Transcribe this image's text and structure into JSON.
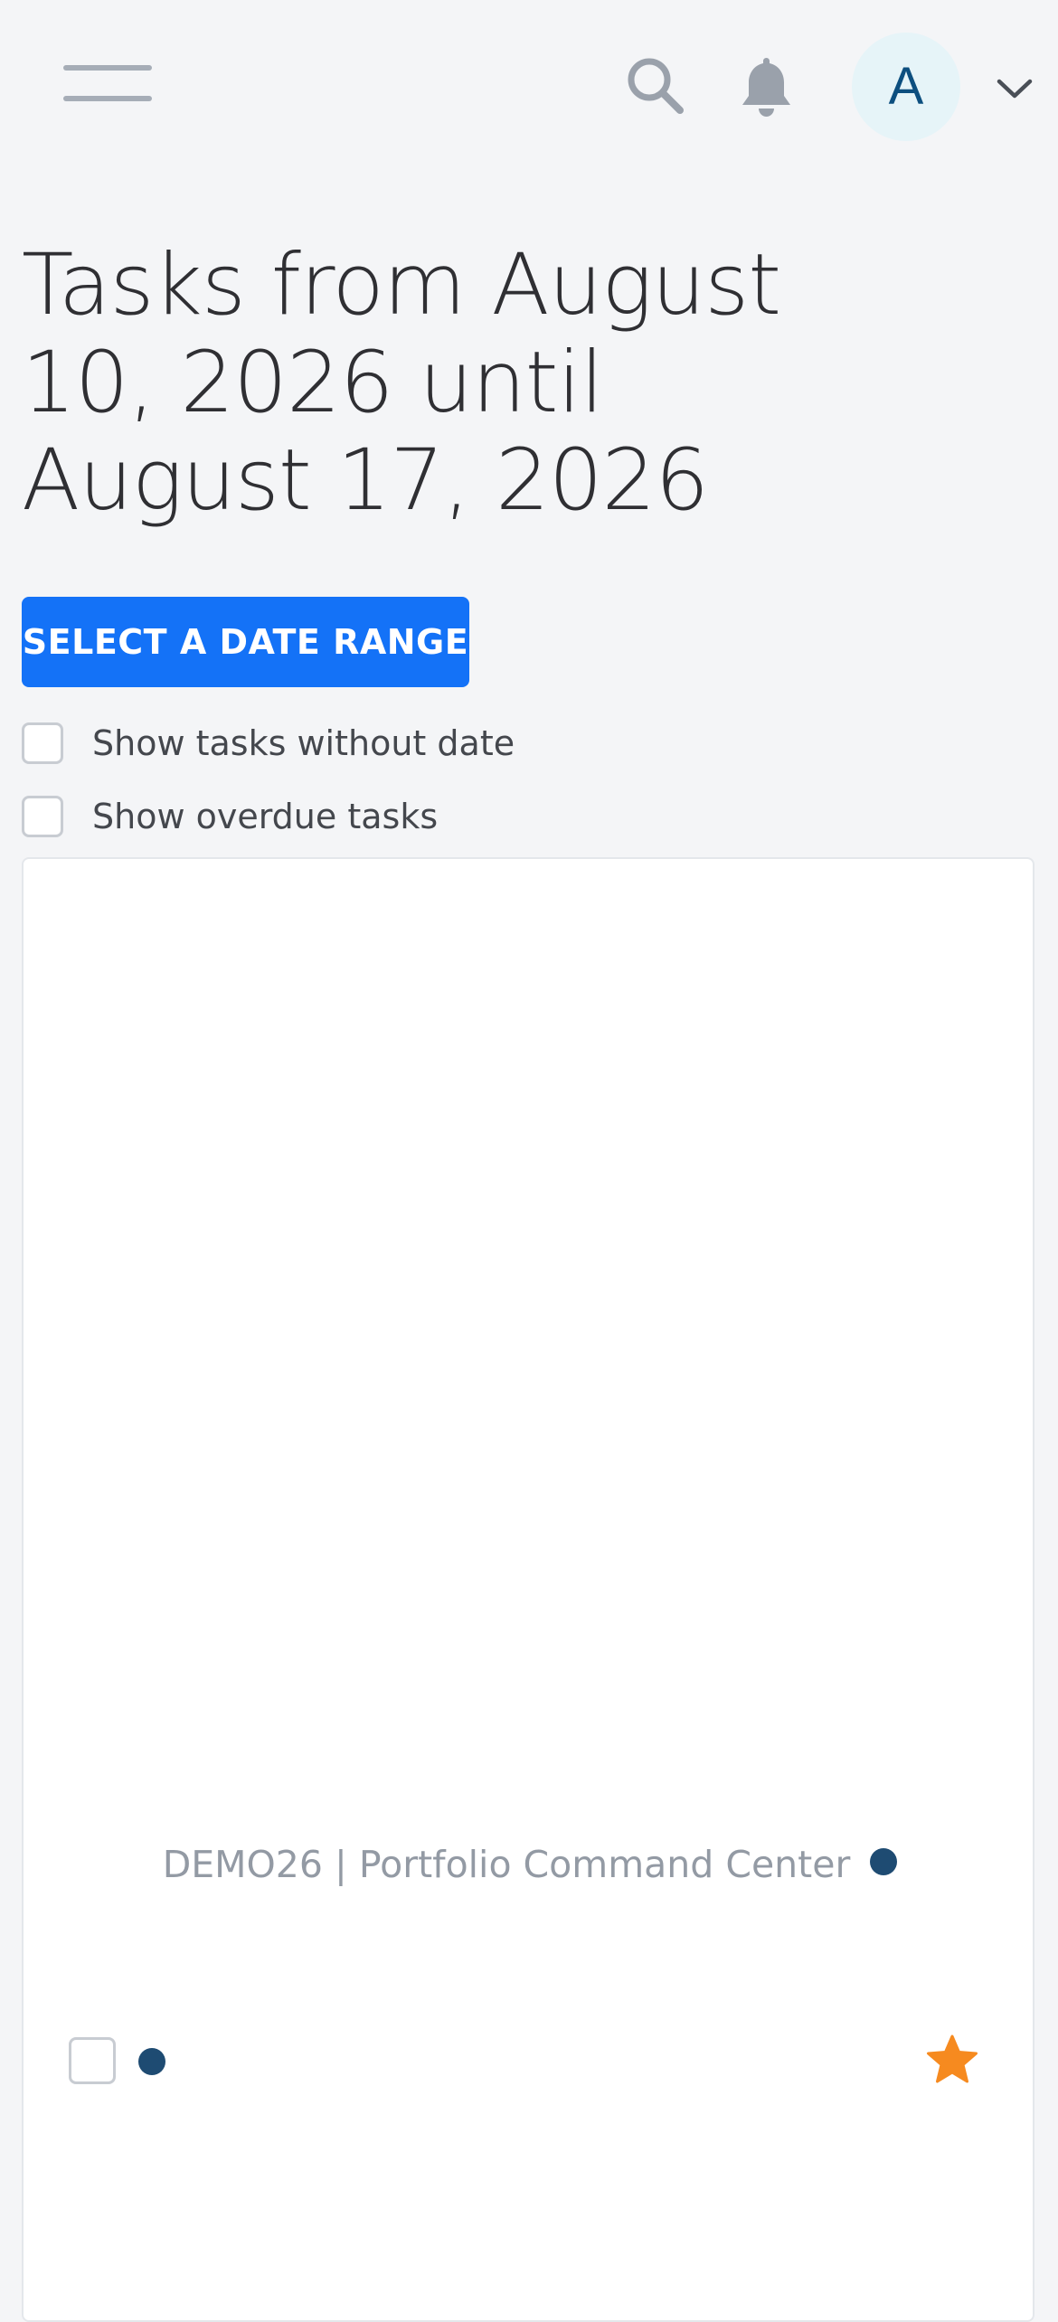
{
  "header": {
    "menu_icon": "hamburger-menu-icon",
    "search_icon": "search-icon",
    "notifications_icon": "bell-icon",
    "avatar_initial": "A",
    "account_dropdown_icon": "chevron-down-icon"
  },
  "page": {
    "title": "Tasks from August 10, 2026 until August 17, 2026",
    "date_range_button": "SELECT A DATE RANGE",
    "show_without_date_label": "Show tasks without date",
    "show_overdue_label": "Show overdue tasks"
  },
  "task_list": {
    "project_name": "DEMO26 | Portfolio Command Center",
    "project_color": "#1e4b72",
    "task": {
      "title": "",
      "favorite": true,
      "star_color": "#f68a1f"
    }
  },
  "colors": {
    "accent": "#1472f7",
    "background": "#f4f5f7",
    "avatar_bg": "#e6f4f8",
    "avatar_text": "#0d4f7f"
  }
}
